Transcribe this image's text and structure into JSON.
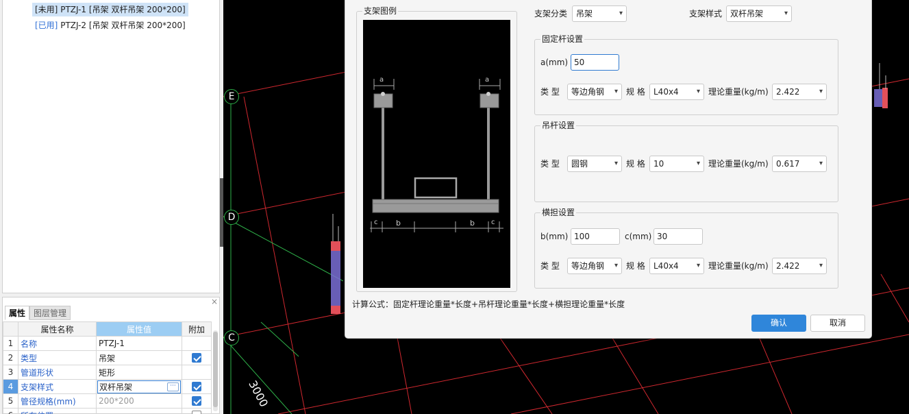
{
  "tree": {
    "items": [
      {
        "status": "[未用]",
        "text": "PTZJ-1 [吊架 双杆吊架 200*200]",
        "selected": true
      },
      {
        "status": "[已用]",
        "text": "PTZJ-2 [吊架 双杆吊架 200*200]",
        "selected": false
      }
    ]
  },
  "props": {
    "close": "×",
    "tabs": [
      "属性",
      "图层管理"
    ],
    "headers": {
      "name": "属性名称",
      "value": "属性值",
      "extra": "附加"
    },
    "rows": [
      {
        "num": "1",
        "name": "名称",
        "value": "PTZJ-1",
        "checkbox": null
      },
      {
        "num": "2",
        "name": "类型",
        "value": "吊架",
        "checkbox": true
      },
      {
        "num": "3",
        "name": "管道形状",
        "value": "矩形",
        "checkbox": null
      },
      {
        "num": "4",
        "name": "支架样式",
        "value": "双杆吊架",
        "checkbox": true
      },
      {
        "num": "5",
        "name": "管径规格(mm)",
        "value": "200*200",
        "checkbox": true
      },
      {
        "num": "6",
        "name": "所在位置",
        "value": "",
        "checkbox": false
      }
    ],
    "dots_label": "···"
  },
  "canvas": {
    "axis_labels": [
      "E",
      "D",
      "C"
    ],
    "dim_text": "3000"
  },
  "dialog": {
    "preview_title": "支架图例",
    "preview_dims": {
      "a": "a",
      "b": "b",
      "c": "c"
    },
    "category_label": "支架分类",
    "category_value": "吊架",
    "style_label": "支架样式",
    "style_value": "双杆吊架",
    "fixed_rod": {
      "title": "固定杆设置",
      "a_label": "a(mm)",
      "a_value": "50",
      "type_label": "类 型",
      "type_value": "等边角钢",
      "spec_label": "规 格",
      "spec_value": "L40x4",
      "weight_label": "理论重量(kg/m)",
      "weight_value": "2.422"
    },
    "hanger_rod": {
      "title": "吊杆设置",
      "type_label": "类 型",
      "type_value": "圆钢",
      "spec_label": "规 格",
      "spec_value": "10",
      "weight_label": "理论重量(kg/m)",
      "weight_value": "0.617"
    },
    "cross_arm": {
      "title": "横担设置",
      "b_label": "b(mm)",
      "b_value": "100",
      "c_label": "c(mm)",
      "c_value": "30",
      "type_label": "类 型",
      "type_value": "等边角钢",
      "spec_label": "规 格",
      "spec_value": "L40x4",
      "weight_label": "理论重量(kg/m)",
      "weight_value": "2.422"
    },
    "formula": "计算公式：固定杆理论重量*长度+吊杆理论重量*长度+横担理论重量*长度",
    "ok_label": "确认",
    "cancel_label": "取消"
  },
  "colors": {
    "accent": "#2f86da",
    "grid_red": "#d0282f",
    "grid_green": "#2fb34a"
  }
}
